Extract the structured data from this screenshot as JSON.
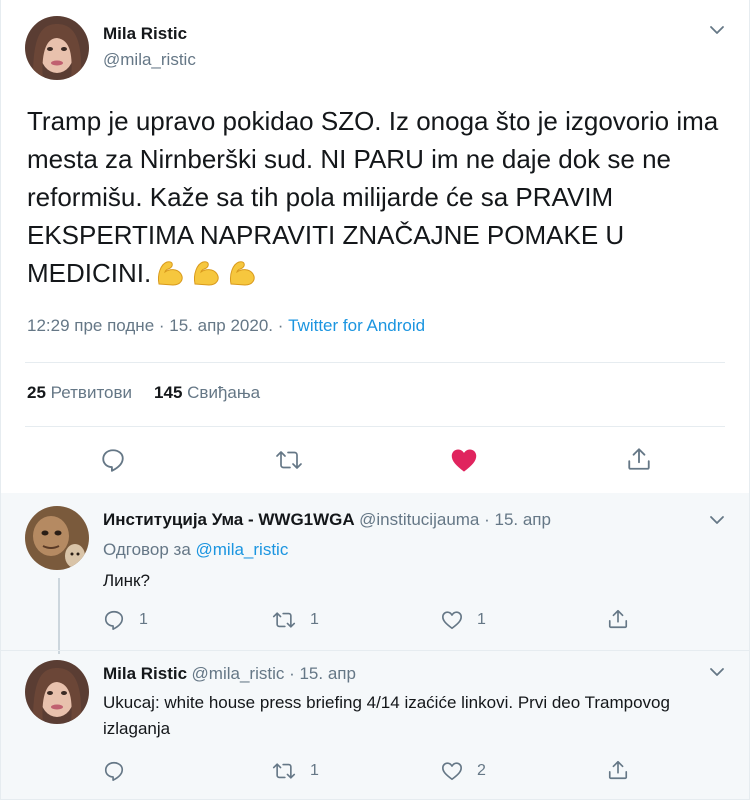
{
  "main": {
    "author_name": "Mila Ristic",
    "author_handle": "@mila_ristic",
    "text": "Tramp je upravo pokidao SZO. Iz onoga što je izgovorio ima mesta za Nirnberški sud. NI PARU im ne daje dok se ne reformišu. Kaže sa tih pola milijarde će sa PRAVIM EKSPERTIMA NAPRAVITI ZNAČAJNE POMAKE U MEDICINI.",
    "emojis": [
      "flexed-biceps-icon",
      "flexed-biceps-icon",
      "flexed-biceps-icon"
    ],
    "timestamp": "12:29 пре подне · 15. апр 2020. · ",
    "source": "Twitter for Android",
    "retweets_count": "25",
    "retweets_label": "Ретвитови",
    "likes_count": "145",
    "likes_label": "Свиђања",
    "like_color": "#e0245e"
  },
  "replies": [
    {
      "author_name": "Институција Ума - WWG1WGA",
      "author_handle": "@institucijauma",
      "date": " · 15. апр",
      "reply_to_label": "Одговор за ",
      "reply_to_handle": "@mila_ristic",
      "text": "Линк?",
      "reply_count": "1",
      "retweet_count": "1",
      "like_count": "1"
    },
    {
      "author_name": "Mila Ristic",
      "author_handle": "@mila_ristic",
      "date": " · 15. апр",
      "text": "Ukucaj: white house press briefing 4/14 izaćiće linkovi. Prvi deo Trampovog izlaganja",
      "reply_count": "",
      "retweet_count": "1",
      "like_count": "2"
    }
  ],
  "colors": {
    "accent": "#1b95e0",
    "muted": "#657786",
    "reply_bg": "#f5f8fa"
  }
}
